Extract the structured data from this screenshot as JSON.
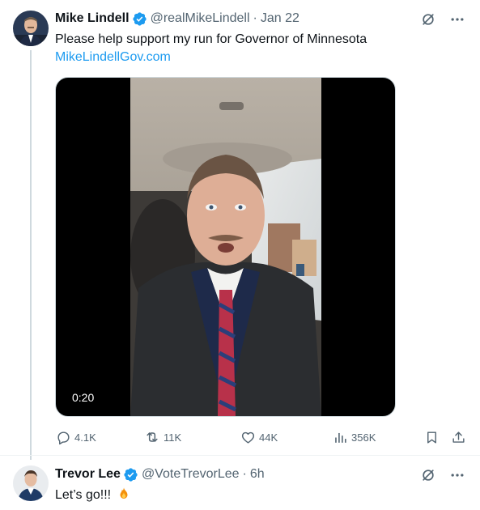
{
  "tweet1": {
    "display_name": "Mike Lindell",
    "handle": "@realMikeLindell",
    "separator": "·",
    "time": "Jan 22",
    "text": "Please help support my run for Governor of Minnesota",
    "link": "MikeLindellGov.com",
    "video_duration": "0:20",
    "reply_count": "4.1K",
    "retweet_count": "11K",
    "like_count": "44K",
    "view_count": "356K"
  },
  "tweet2": {
    "display_name": "Trevor Lee",
    "handle": "@VoteTrevorLee",
    "separator": "·",
    "time": "6h",
    "text": "Let’s go!!!"
  },
  "colors": {
    "accent": "#1d9bf0",
    "secondary_text": "#536471",
    "verified": "#1d9bf0",
    "thread_line": "#cfd9de"
  },
  "icons": {
    "verified": "verified-badge-icon",
    "grok": "grok-icon",
    "more": "more-icon",
    "reply": "reply-icon",
    "retweet": "retweet-icon",
    "like": "heart-icon",
    "views": "views-icon",
    "bookmark": "bookmark-icon",
    "share": "share-icon",
    "fire": "fire-emoji-icon"
  }
}
